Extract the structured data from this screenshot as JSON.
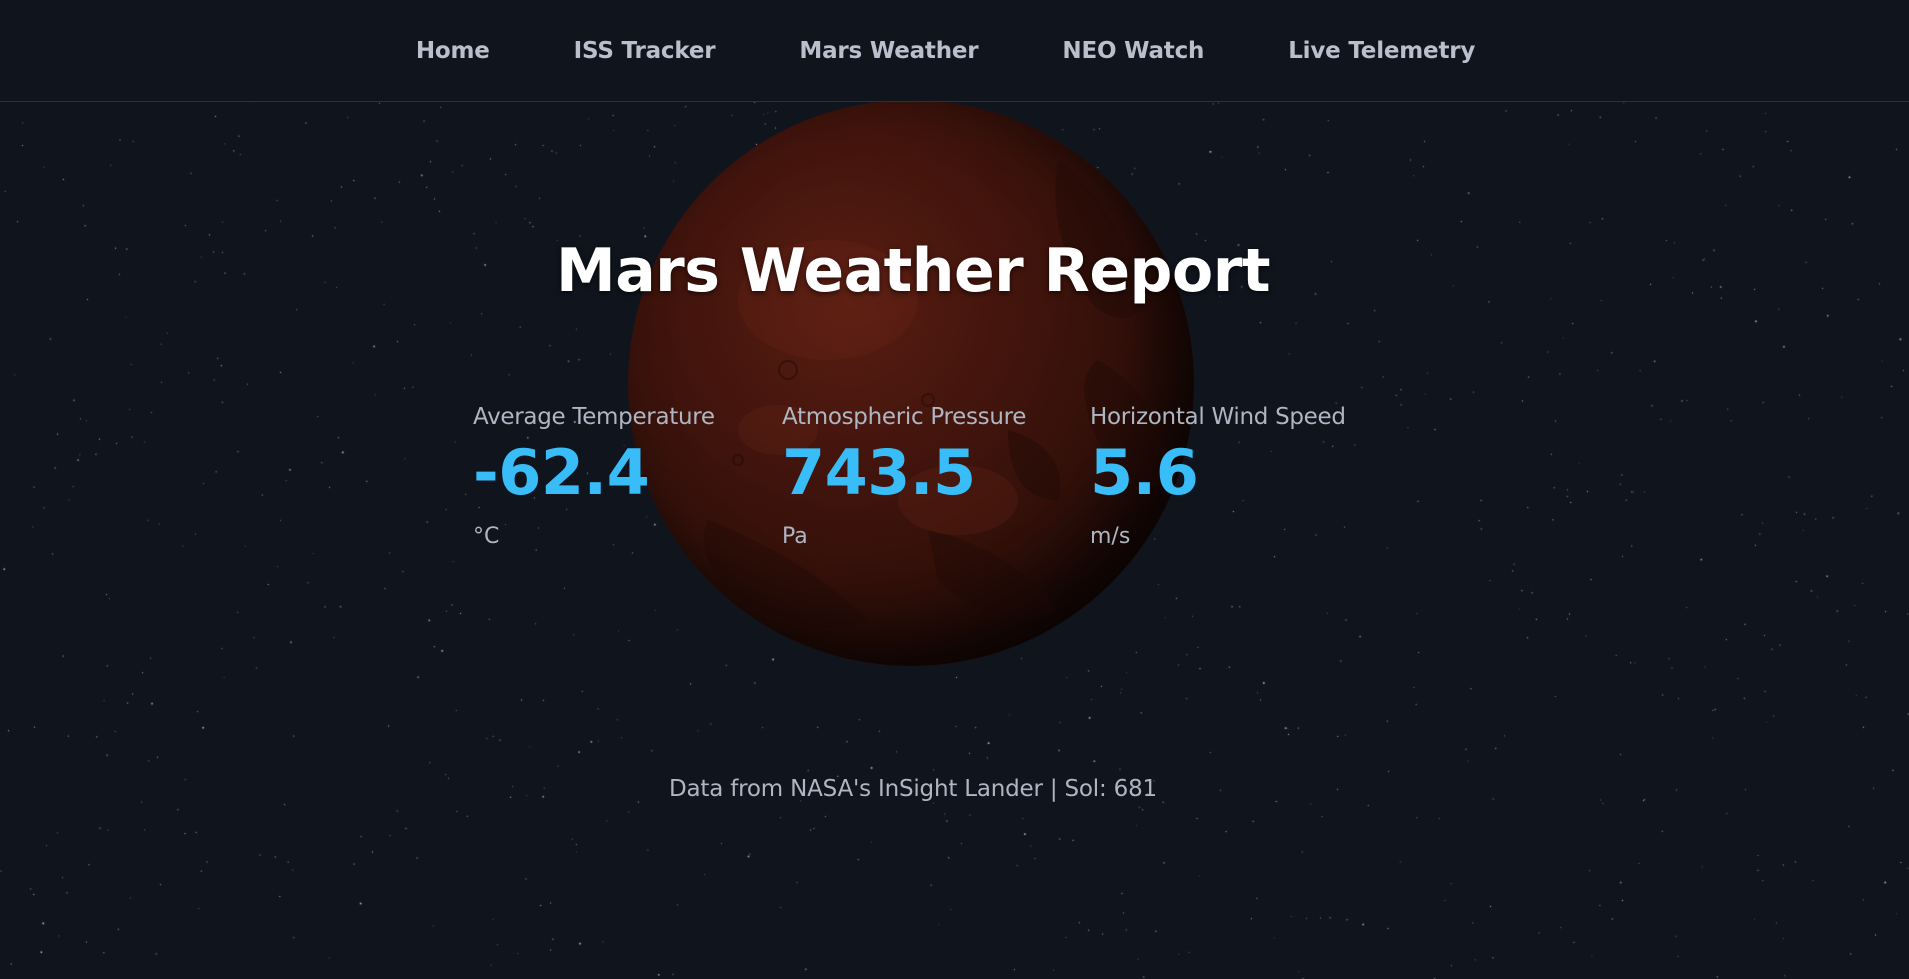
{
  "nav": {
    "items": [
      {
        "label": "Home"
      },
      {
        "label": "ISS Tracker"
      },
      {
        "label": "Mars Weather"
      },
      {
        "label": "NEO Watch"
      },
      {
        "label": "Live Telemetry"
      }
    ]
  },
  "main": {
    "title": "Mars Weather Report",
    "metrics": [
      {
        "label": "Average Temperature",
        "value": "-62.4",
        "unit": "°C"
      },
      {
        "label": "Atmospheric Pressure",
        "value": "743.5",
        "unit": "Pa"
      },
      {
        "label": "Horizontal Wind Speed",
        "value": "5.6",
        "unit": "m/s"
      }
    ]
  },
  "footer": {
    "text": "Data from NASA's InSight Lander | Sol: 681"
  },
  "colors": {
    "background": "#0f141d",
    "accent": "#38bdf8",
    "mars": "#4a170e"
  }
}
